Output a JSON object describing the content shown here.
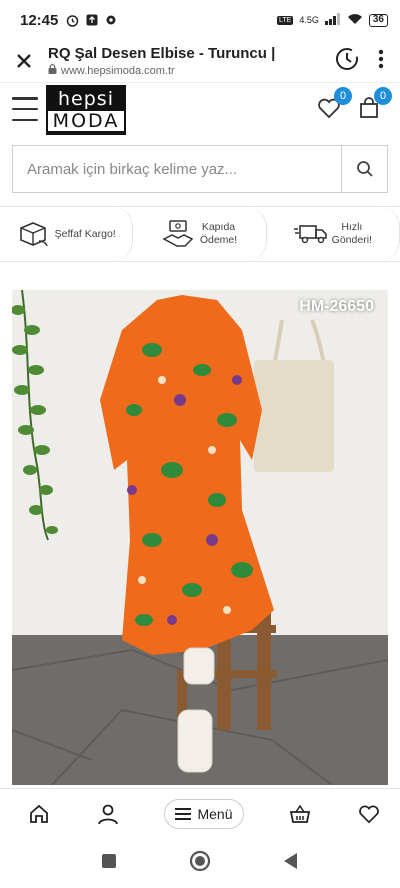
{
  "status": {
    "time": "12:45",
    "net_label": "4.5G",
    "battery": "36"
  },
  "browser": {
    "title": "RQ Şal Desen Elbise - Turuncu |",
    "url": "www.hepsimoda.com.tr"
  },
  "header": {
    "logo_top": "hepsi",
    "logo_bottom": "MODA",
    "wishlist_count": "0",
    "cart_count": "0"
  },
  "search": {
    "placeholder": "Aramak için birkaç kelime yaz..."
  },
  "features": [
    {
      "label": "Şeffaf Kargo!",
      "icon": "box-icon"
    },
    {
      "label": "Kapıda\nÖdeme!",
      "icon": "handshake-icon"
    },
    {
      "label": "Hızlı\nGönderi!",
      "icon": "truck-icon"
    }
  ],
  "product": {
    "code": "HM-26650"
  },
  "bottom_nav": {
    "menu_label": "Menü"
  }
}
